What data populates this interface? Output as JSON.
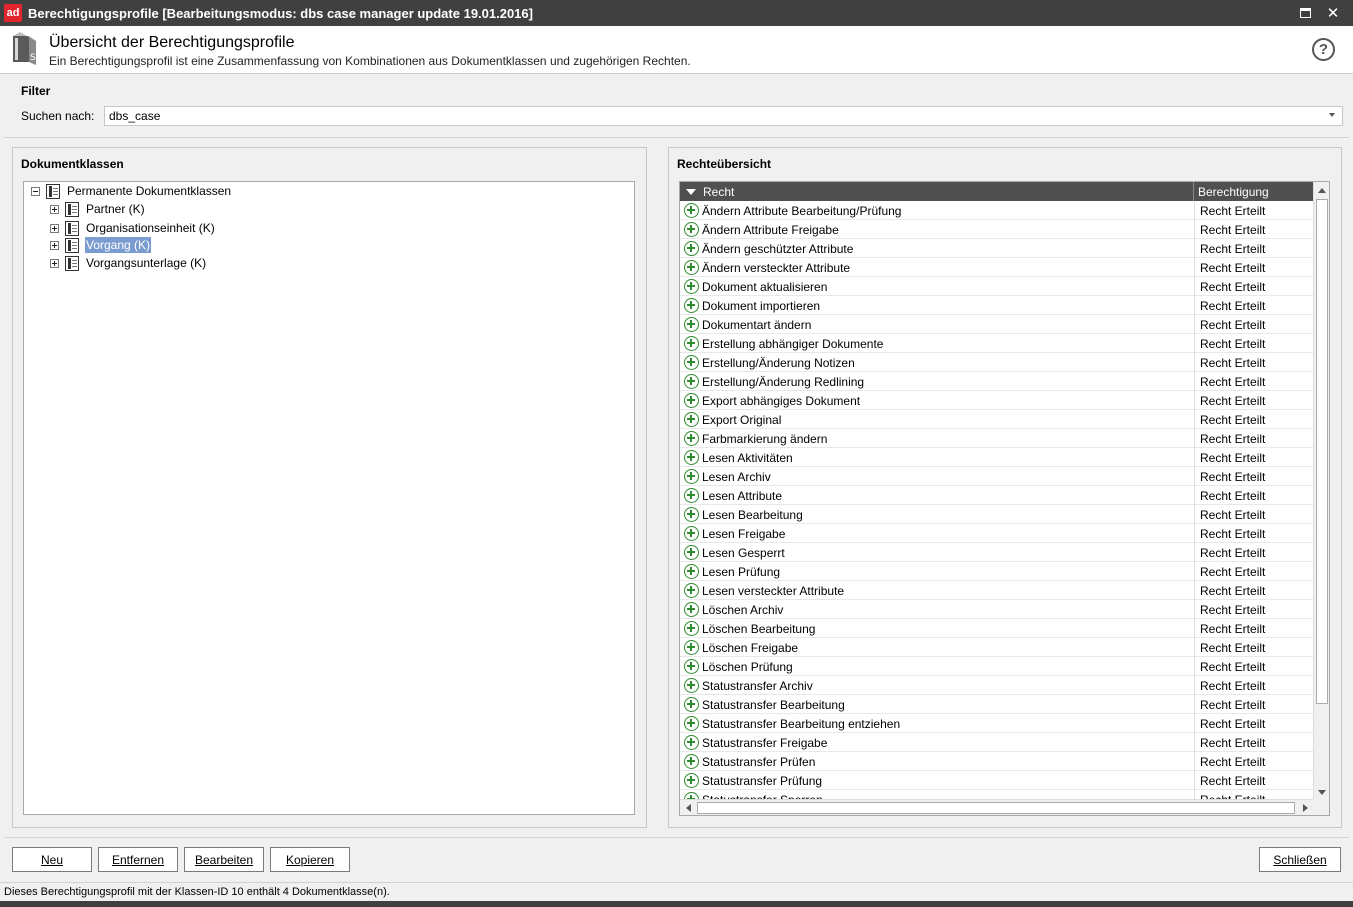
{
  "window": {
    "logo": "ad",
    "title": "Berechtigungsprofile [Bearbeitungsmodus: dbs case manager update 19.01.2016]"
  },
  "header": {
    "title": "Übersicht der Berechtigungsprofile",
    "description": "Ein Berechtigungsprofil ist eine Zusammenfassung von Kombinationen aus Dokumentklassen und zugehörigen Rechten.",
    "help": "?"
  },
  "filter": {
    "heading": "Filter",
    "search_label": "Suchen nach:",
    "search_value": "dbs_case"
  },
  "left_panel": {
    "title": "Dokumentklassen",
    "tree": {
      "root": "Permanente Dokumentklassen",
      "children": [
        {
          "label": "Partner (K)",
          "selected": false
        },
        {
          "label": "Organisationseinheit (K)",
          "selected": false
        },
        {
          "label": "Vorgang (K)",
          "selected": true
        },
        {
          "label": "Vorgangsunterlage (K)",
          "selected": false
        }
      ]
    }
  },
  "right_panel": {
    "title": "Rechteübersicht",
    "columns": {
      "recht": "Recht",
      "berechtigung": "Berechtigung"
    },
    "rows": [
      {
        "recht": "Ändern Attribute Bearbeitung/Prüfung",
        "berechtigung": "Recht Erteilt"
      },
      {
        "recht": "Ändern Attribute Freigabe",
        "berechtigung": "Recht Erteilt"
      },
      {
        "recht": "Ändern geschützter Attribute",
        "berechtigung": "Recht Erteilt"
      },
      {
        "recht": "Ändern versteckter Attribute",
        "berechtigung": "Recht Erteilt"
      },
      {
        "recht": "Dokument aktualisieren",
        "berechtigung": "Recht Erteilt"
      },
      {
        "recht": "Dokument importieren",
        "berechtigung": "Recht Erteilt"
      },
      {
        "recht": "Dokumentart ändern",
        "berechtigung": "Recht Erteilt"
      },
      {
        "recht": "Erstellung abhängiger Dokumente",
        "berechtigung": "Recht Erteilt"
      },
      {
        "recht": "Erstellung/Änderung Notizen",
        "berechtigung": "Recht Erteilt"
      },
      {
        "recht": "Erstellung/Änderung Redlining",
        "berechtigung": "Recht Erteilt"
      },
      {
        "recht": "Export abhängiges Dokument",
        "berechtigung": "Recht Erteilt"
      },
      {
        "recht": "Export Original",
        "berechtigung": "Recht Erteilt"
      },
      {
        "recht": "Farbmarkierung ändern",
        "berechtigung": "Recht Erteilt"
      },
      {
        "recht": "Lesen Aktivitäten",
        "berechtigung": "Recht Erteilt"
      },
      {
        "recht": "Lesen Archiv",
        "berechtigung": "Recht Erteilt"
      },
      {
        "recht": "Lesen Attribute",
        "berechtigung": "Recht Erteilt"
      },
      {
        "recht": "Lesen Bearbeitung",
        "berechtigung": "Recht Erteilt"
      },
      {
        "recht": "Lesen Freigabe",
        "berechtigung": "Recht Erteilt"
      },
      {
        "recht": "Lesen Gesperrt",
        "berechtigung": "Recht Erteilt"
      },
      {
        "recht": "Lesen Prüfung",
        "berechtigung": "Recht Erteilt"
      },
      {
        "recht": "Lesen versteckter Attribute",
        "berechtigung": "Recht Erteilt"
      },
      {
        "recht": "Löschen Archiv",
        "berechtigung": "Recht Erteilt"
      },
      {
        "recht": "Löschen Bearbeitung",
        "berechtigung": "Recht Erteilt"
      },
      {
        "recht": "Löschen Freigabe",
        "berechtigung": "Recht Erteilt"
      },
      {
        "recht": "Löschen Prüfung",
        "berechtigung": "Recht Erteilt"
      },
      {
        "recht": "Statustransfer Archiv",
        "berechtigung": "Recht Erteilt"
      },
      {
        "recht": "Statustransfer Bearbeitung",
        "berechtigung": "Recht Erteilt"
      },
      {
        "recht": "Statustransfer Bearbeitung entziehen",
        "berechtigung": "Recht Erteilt"
      },
      {
        "recht": "Statustransfer Freigabe",
        "berechtigung": "Recht Erteilt"
      },
      {
        "recht": "Statustransfer Prüfen",
        "berechtigung": "Recht Erteilt"
      },
      {
        "recht": "Statustransfer Prüfung",
        "berechtigung": "Recht Erteilt"
      },
      {
        "recht": "Statustransfer Sperren",
        "berechtigung": "Recht Erteilt"
      }
    ]
  },
  "buttons": {
    "neu": "Neu",
    "entfernen": "Entfernen",
    "bearbeiten": "Bearbeiten",
    "kopieren": "Kopieren",
    "schliessen": "Schließen"
  },
  "status": "Dieses Berechtigungsprofil mit der Klassen-ID 10 enthält 4 Dokumentklasse(n).",
  "colors": {
    "titlebar": "#404040",
    "selection": "#7a9cd0",
    "logo": "#e3262e",
    "plus_icon": "#2e8b2e"
  }
}
